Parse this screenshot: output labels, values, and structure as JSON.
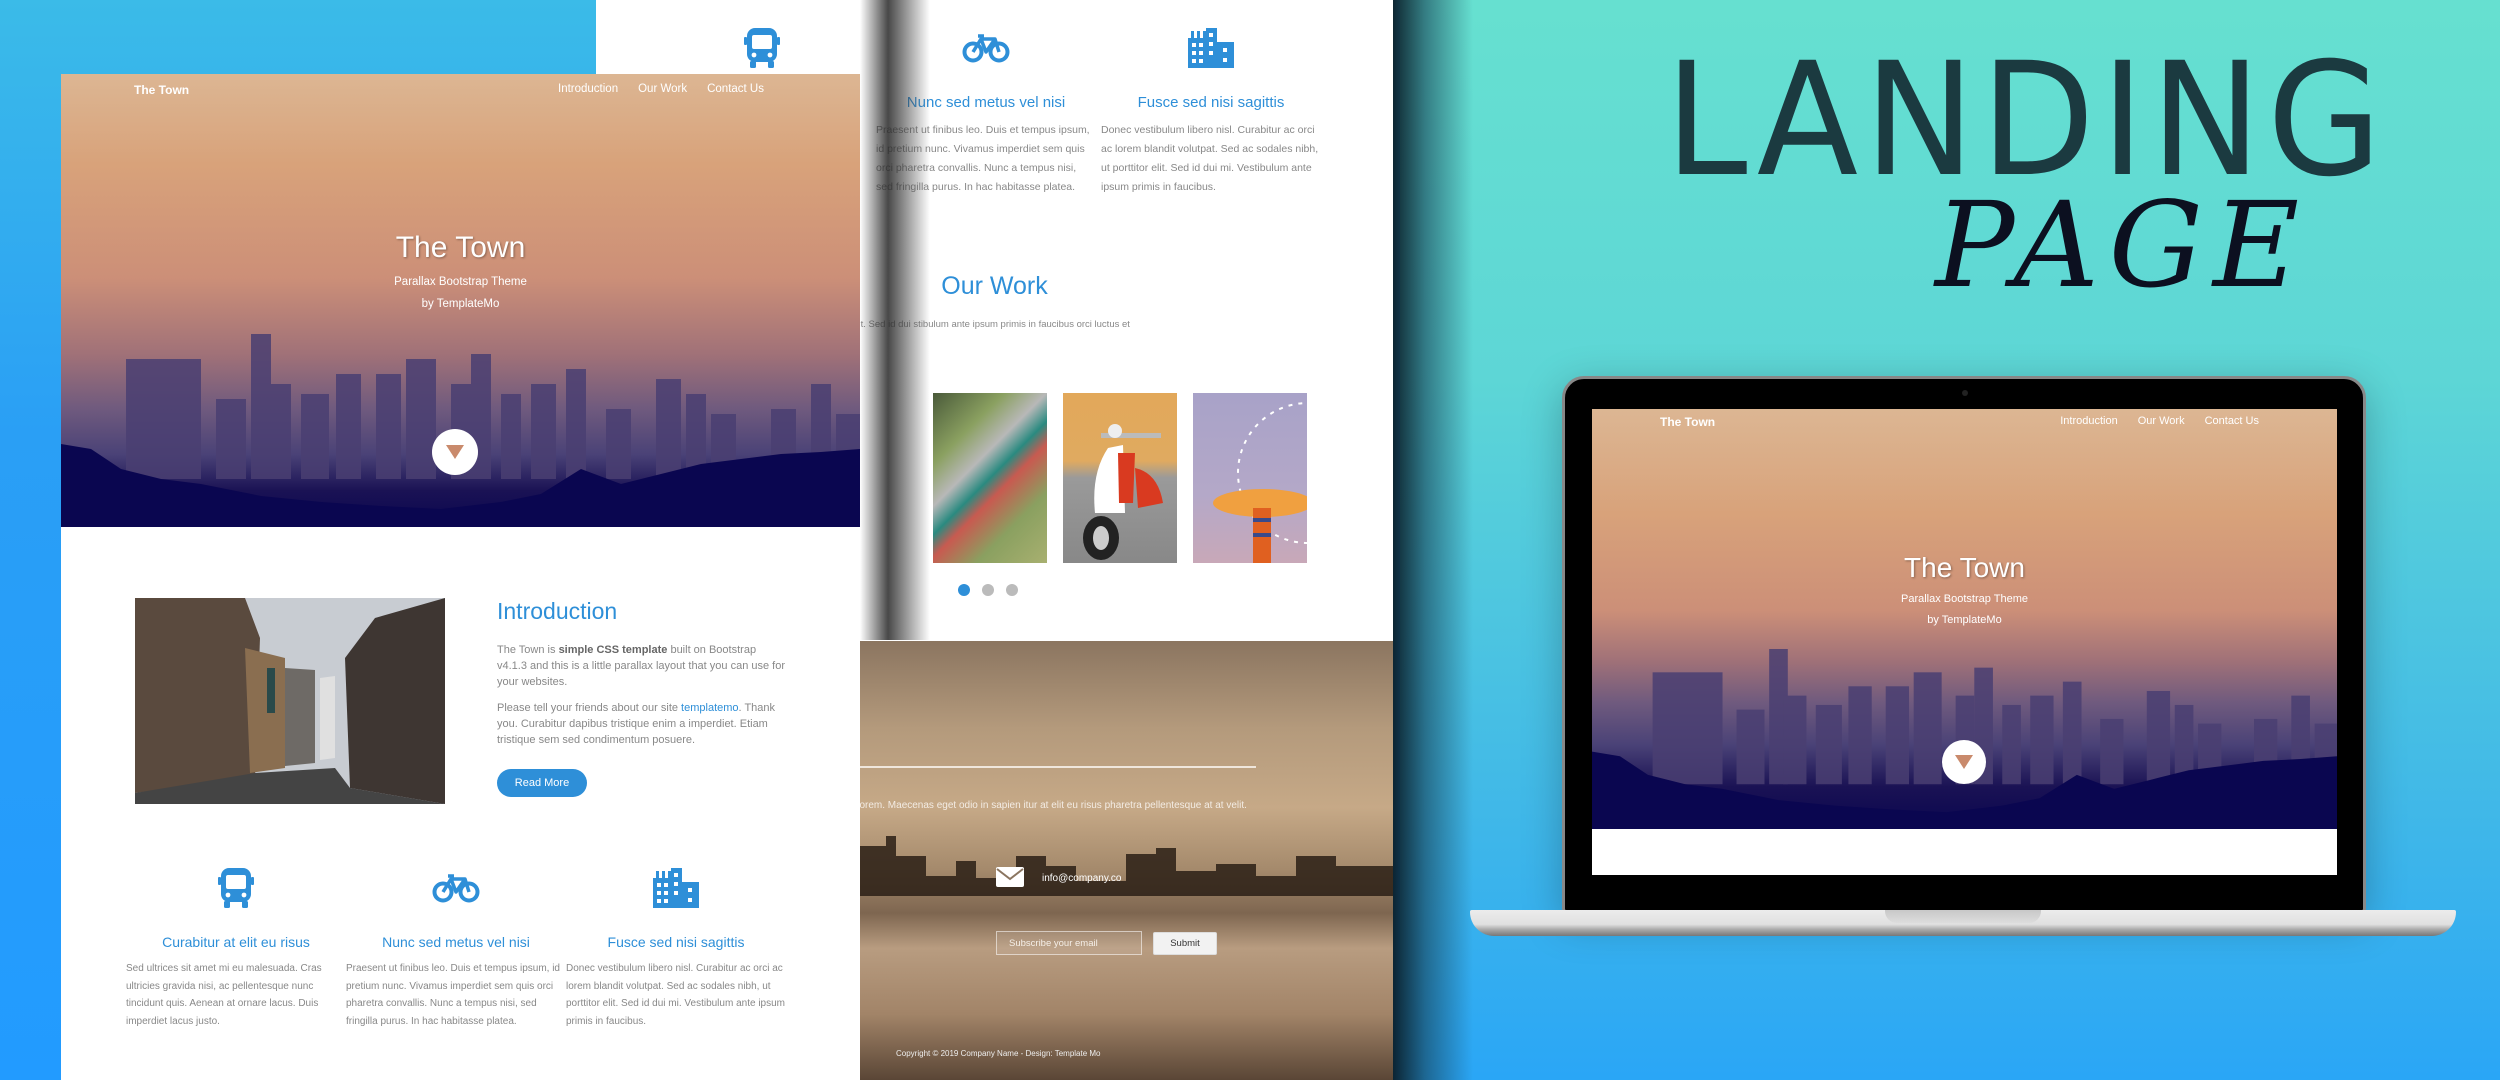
{
  "poster": {
    "headline_line1": "LANDING",
    "headline_line2": "PAGE",
    "accent_color": "#2e8fd8"
  },
  "site": {
    "brand": "The Town",
    "nav": [
      "Introduction",
      "Our Work",
      "Contact Us"
    ],
    "hero": {
      "title": "The Town",
      "subtitle": "Parallax Bootstrap Theme",
      "byline": "by TemplateMo",
      "scroll_icon": "caret-down-icon"
    },
    "intro": {
      "title": "Introduction",
      "p1_prefix": "The Town is ",
      "p1_bold": "simple CSS template",
      "p1_suffix": " built on Bootstrap v4.1.3 and this is a little parallax layout that you can use for your websites.",
      "p2_prefix": "Please tell your friends about our site ",
      "p2_link": "templatemo",
      "p2_suffix": ". Thank you. Curabitur dapibus tristique enim a imperdiet. Etiam tristique sem sed condimentum posuere.",
      "button": "Read More"
    },
    "services": [
      {
        "icon": "bus-icon",
        "title": "Curabitur at elit eu risus",
        "text": "Sed ultrices sit amet mi eu malesuada. Cras ultricies gravida nisi, ac pellentesque nunc tincidunt quis. Aenean at ornare lacus. Duis imperdiet lacus justo."
      },
      {
        "icon": "bicycle-icon",
        "title": "Nunc sed metus vel nisi",
        "text": "Praesent ut finibus leo. Duis et tempus ipsum, id pretium nunc. Vivamus imperdiet sem quis orci pharetra convallis. Nunc a tempus nisi, sed fringilla purus. In hac habitasse platea."
      },
      {
        "icon": "building-icon",
        "title": "Fusce sed nisi sagittis",
        "text": "Donec vestibulum libero nisl. Curabitur ac orci ac lorem blandit volutpat. Sed ac sodales nibh, ut porttitor elit. Sed id dui mi. Vestibulum ante ipsum primis in faucibus."
      }
    ],
    "work": {
      "title": "Our Work",
      "text": "ac orci ac lorem blandit volutpat. Sed ac sodales nibh, ut porttitor elit. Sed id dui stibulum ante ipsum primis in faucibus orci luctus et ultrices posuere cubilia.\"",
      "thumbnails": [
        "forest-road",
        "aerial-plaza",
        "red-scooter",
        "ferris-wheel"
      ],
      "carousel_pages": 3,
      "carousel_active": 1
    },
    "contact": {
      "text": "luctus, elit turpis tincidunt dui, non tempus sem turpis vitae lorem. Maecenas eget odio in sapien itur at elit eu risus pharetra pellentesque at at velit.",
      "email": "info@company.co",
      "subscribe_placeholder": "Subscribe your email",
      "submit": "Submit",
      "copyright": "Copyright © 2019 Company Name - Design: Template Mo"
    }
  }
}
